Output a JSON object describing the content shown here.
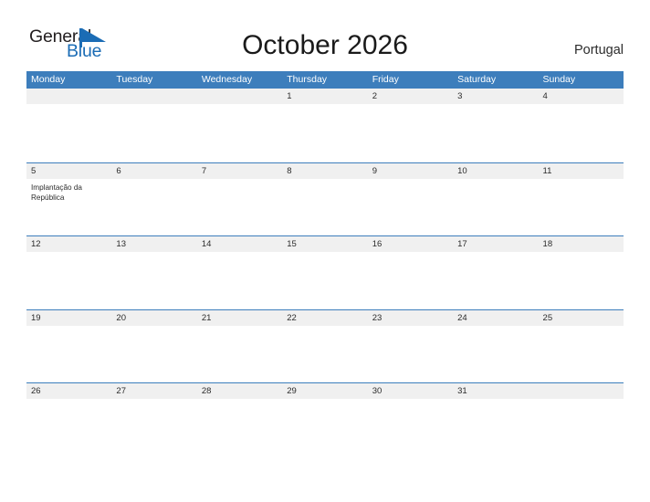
{
  "brand": {
    "name_part1": "General",
    "name_part2": "Blue",
    "flag_icon": "blue-flag-triangle-icon",
    "color_dark": "#231f20",
    "color_blue": "#1b6cb5"
  },
  "header": {
    "title": "October 2026",
    "country": "Portugal"
  },
  "theme": {
    "header_blue": "#3d7ebc",
    "band_gray": "#f0f0f0",
    "row_border_blue": "#3d7ebc",
    "text_dark": "#2b2b2b"
  },
  "calendar": {
    "month": "October",
    "year": "2026",
    "weekdays": [
      "Monday",
      "Tuesday",
      "Wednesday",
      "Thursday",
      "Friday",
      "Saturday",
      "Sunday"
    ],
    "weeks": [
      {
        "bordered": false,
        "days": [
          {
            "num": "",
            "event": ""
          },
          {
            "num": "",
            "event": ""
          },
          {
            "num": "",
            "event": ""
          },
          {
            "num": "1",
            "event": ""
          },
          {
            "num": "2",
            "event": ""
          },
          {
            "num": "3",
            "event": ""
          },
          {
            "num": "4",
            "event": ""
          }
        ]
      },
      {
        "bordered": true,
        "days": [
          {
            "num": "5",
            "event": "Implantação da República"
          },
          {
            "num": "6",
            "event": ""
          },
          {
            "num": "7",
            "event": ""
          },
          {
            "num": "8",
            "event": ""
          },
          {
            "num": "9",
            "event": ""
          },
          {
            "num": "10",
            "event": ""
          },
          {
            "num": "11",
            "event": ""
          }
        ]
      },
      {
        "bordered": true,
        "days": [
          {
            "num": "12",
            "event": ""
          },
          {
            "num": "13",
            "event": ""
          },
          {
            "num": "14",
            "event": ""
          },
          {
            "num": "15",
            "event": ""
          },
          {
            "num": "16",
            "event": ""
          },
          {
            "num": "17",
            "event": ""
          },
          {
            "num": "18",
            "event": ""
          }
        ]
      },
      {
        "bordered": true,
        "days": [
          {
            "num": "19",
            "event": ""
          },
          {
            "num": "20",
            "event": ""
          },
          {
            "num": "21",
            "event": ""
          },
          {
            "num": "22",
            "event": ""
          },
          {
            "num": "23",
            "event": ""
          },
          {
            "num": "24",
            "event": ""
          },
          {
            "num": "25",
            "event": ""
          }
        ]
      },
      {
        "bordered": true,
        "days": [
          {
            "num": "26",
            "event": ""
          },
          {
            "num": "27",
            "event": ""
          },
          {
            "num": "28",
            "event": ""
          },
          {
            "num": "29",
            "event": ""
          },
          {
            "num": "30",
            "event": ""
          },
          {
            "num": "31",
            "event": ""
          },
          {
            "num": "",
            "event": ""
          }
        ]
      }
    ]
  }
}
